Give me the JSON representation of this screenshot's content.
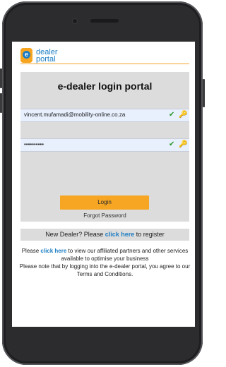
{
  "brand": {
    "logo_letter": "e",
    "name_line1": "dealer",
    "name_line2": "portal"
  },
  "login": {
    "title": "e-dealer login portal",
    "username_value": "vincent.mufamadi@mobility-online.co.za",
    "password_value": "••••••••••",
    "login_button_label": "Login",
    "forgot_password_label": "Forgot Password"
  },
  "register": {
    "prefix": "New Dealer? Please ",
    "link_text": "click here",
    "suffix": " to register"
  },
  "info": {
    "prefix": "Please ",
    "link_text": "click here",
    "suffix": " to view our affiliated partners and other services available to optimise your business",
    "terms_note": "Please note that by logging into the e-dealer portal, you agree to our Terms and Conditions."
  },
  "icons": {
    "field_valid": "check-icon",
    "field_key": "key-icon"
  },
  "colors": {
    "accent_orange": "#f6a623",
    "brand_blue": "#1d7dc3",
    "panel_grey": "#dcdcdc",
    "valid_green": "#2a9a2a"
  }
}
